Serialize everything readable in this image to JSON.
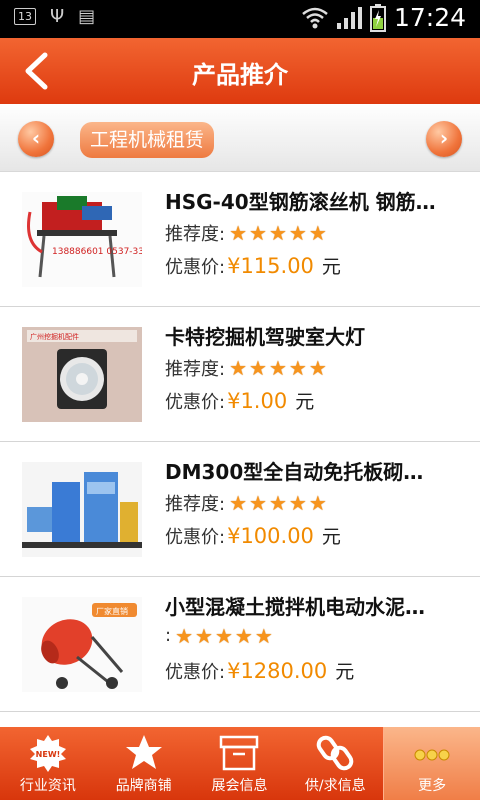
{
  "status_bar": {
    "badge": "13",
    "time": "17:24"
  },
  "header": {
    "title": "产品推介"
  },
  "category": {
    "label": "工程机械租赁"
  },
  "products": [
    {
      "name": "HSG-40型钢筋滚丝机 钢筋…",
      "rec_label": "推荐度:",
      "rating": 5,
      "price_label": "优惠价:",
      "price": "¥115.00",
      "unit": "元"
    },
    {
      "name": "卡特挖掘机驾驶室大灯",
      "rec_label": "推荐度:",
      "rating": 5,
      "price_label": "优惠价:",
      "price": "¥1.00",
      "unit": "元"
    },
    {
      "name": "DM300型全自动免托板砌…",
      "rec_label": "推荐度:",
      "rating": 5,
      "price_label": "优惠价:",
      "price": "¥100.00",
      "unit": "元"
    },
    {
      "name": "小型混凝土搅拌机电动水泥…",
      "rec_label": ":",
      "rating": 5,
      "price_label": "优惠价:",
      "price": "¥1280.00",
      "unit": "元"
    }
  ],
  "thumbs": {
    "p1_text": "138886601\n0537-338",
    "p2_text": "广州挖掘机配件",
    "p4_text": "厂家直销"
  },
  "nav": [
    {
      "label": "行业资讯",
      "badge": "NEW!"
    },
    {
      "label": "品牌商铺"
    },
    {
      "label": "展会信息"
    },
    {
      "label": "供/求信息"
    },
    {
      "label": "更多"
    }
  ],
  "colors": {
    "brand": "#e94a1c",
    "price": "#f18a00",
    "star": "#f7941d"
  }
}
